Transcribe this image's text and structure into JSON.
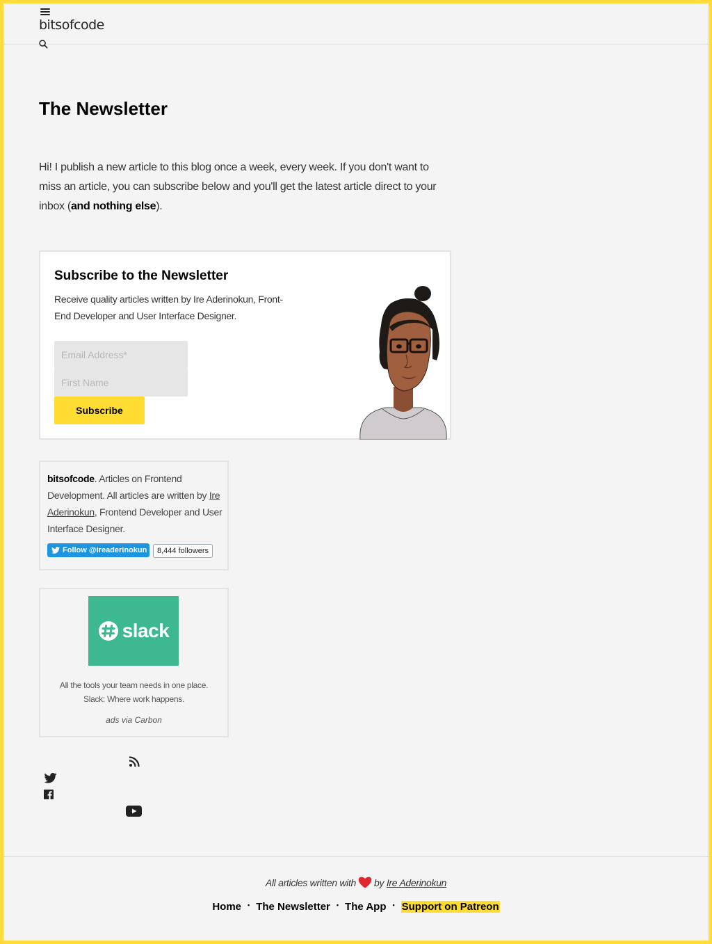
{
  "header": {
    "logo": "bitsofcode",
    "menu_icon": "hamburger-menu-icon",
    "search_icon": "search-icon"
  },
  "page": {
    "title": "The Newsletter",
    "intro_part1": "Hi! I publish a new article to this blog once a week, every week. If you don't want to miss an article, you can subscribe below and you'll get the latest article direct to your inbox (",
    "intro_bold": "and nothing else",
    "intro_part2": ")."
  },
  "subscribe": {
    "title": "Subscribe to the Newsletter",
    "description": "Receive quality articles written by Ire Aderinokun, Front-End Developer and User Interface Designer.",
    "email_placeholder": "Email Address*",
    "name_placeholder": "First Name",
    "button_label": "Subscribe"
  },
  "about": {
    "brand": "bitsofcode",
    "text_after_brand": ". Articles on Frontend Development. All articles are written by ",
    "author_link": "Ire Aderinokun",
    "text_end": ", Frontend Developer and User Interface Designer.",
    "follow_label": "Follow @ireaderinokun",
    "followers": "8,444 followers"
  },
  "ad": {
    "brand": "slack",
    "text": "All the tools your team needs in one place. Slack: Where work happens.",
    "via": "ads via Carbon"
  },
  "social": {
    "icons": [
      "rss-icon",
      "twitter-icon",
      "facebook-icon",
      "youtube-icon"
    ]
  },
  "footer": {
    "credit_prefix": "All articles written with",
    "credit_by": "by",
    "credit_author": "Ire Aderinokun",
    "nav": [
      "Home",
      "The Newsletter",
      "The App",
      "Support on Patreon"
    ],
    "separator": "•"
  },
  "colors": {
    "accent": "#ffdc32",
    "background": "#f4f4f4",
    "twitter": "#1b95e0",
    "slack": "#3eb891"
  }
}
